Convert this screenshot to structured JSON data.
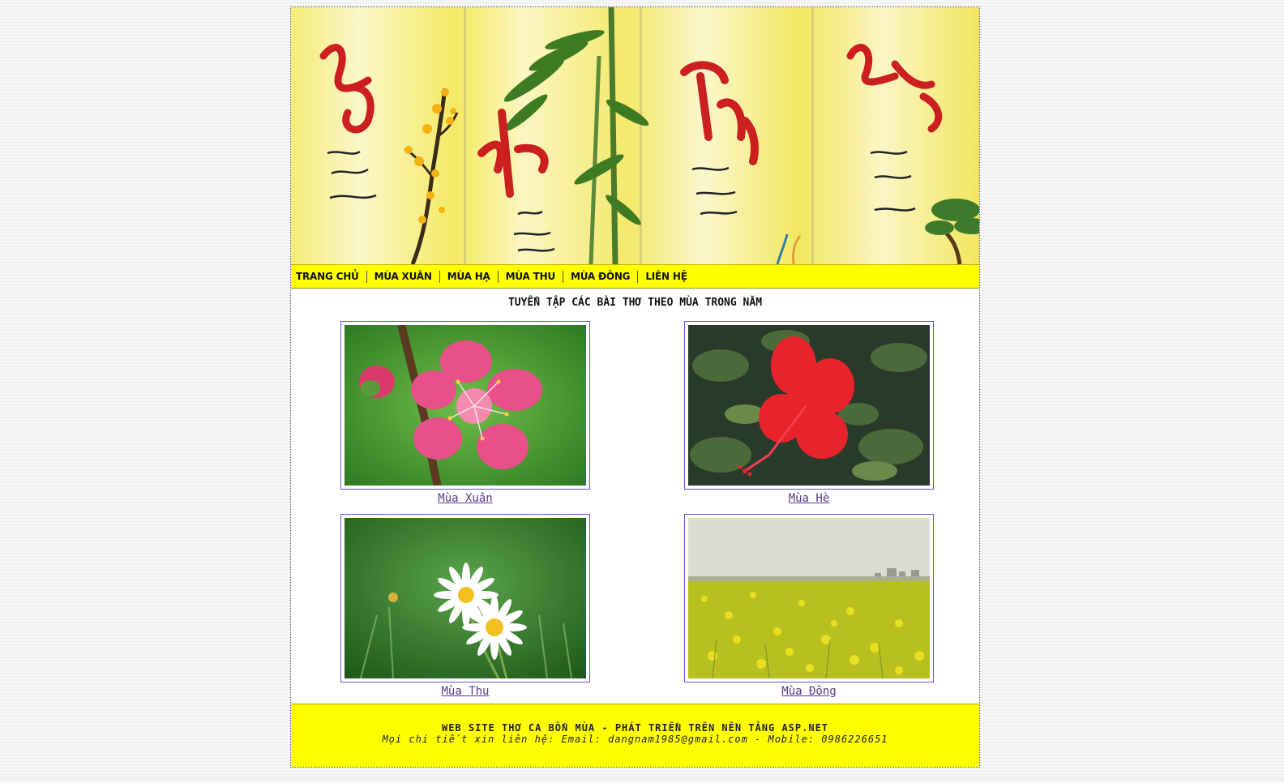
{
  "nav": {
    "items": [
      {
        "label": "TRANG CHỦ"
      },
      {
        "label": "MÙA XUÂN"
      },
      {
        "label": "MÙA HẠ"
      },
      {
        "label": "MÙA THU"
      },
      {
        "label": "MÙA ĐÔNG"
      },
      {
        "label": "LIÊN HỆ"
      }
    ]
  },
  "main": {
    "title": "TUYỂN TẬP CÁC BÀI THƠ THEO MÙA TRONG NĂM",
    "seasons": [
      {
        "caption": "Mùa Xuân"
      },
      {
        "caption": "Mùa Hè"
      },
      {
        "caption": "Mùa Thu"
      },
      {
        "caption": "Mùa Đông"
      }
    ]
  },
  "footer": {
    "line1": "WEB SITE THƠ CA BỐN MÙA - PHÁT TRIỂN TRÊN NỀN TẢNG ASP.NET",
    "line2": "Mọi chi tiết xin liên hệ: Email: dangnam1985@gmail.com - Mobile: 0986226651"
  },
  "colors": {
    "nav_bg": "#ffff00",
    "footer_bg": "#ffff00",
    "link": "#5a3a8a",
    "frame_border": "#5b5bd6"
  },
  "icons": {
    "banner": "calligraphy-four-seasons-banner"
  }
}
